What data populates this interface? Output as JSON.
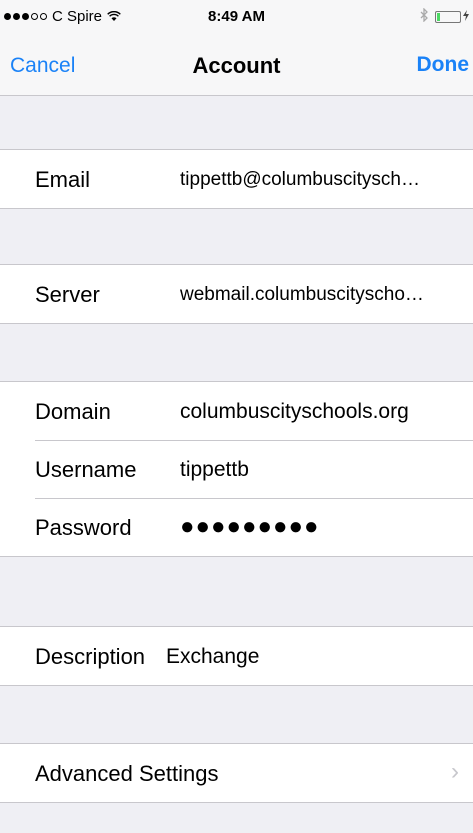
{
  "status_bar": {
    "carrier": "C Spire",
    "time": "8:49 AM",
    "signal_full": 3,
    "signal_empty": 2,
    "icons": [
      "wifi-icon",
      "bluetooth-icon",
      "battery-icon",
      "charging-icon"
    ]
  },
  "nav": {
    "cancel_label": "Cancel",
    "title": "Account",
    "done_label": "Done"
  },
  "fields": {
    "email": {
      "label": "Email",
      "value": "tippettb@columbuscitysch…"
    },
    "server": {
      "label": "Server",
      "value": "webmail.columbuscityscho…"
    },
    "domain": {
      "label": "Domain",
      "value": "columbuscityschools.org"
    },
    "username": {
      "label": "Username",
      "value": "tippettb"
    },
    "password": {
      "label": "Password",
      "value": "●●●●●●●●●"
    },
    "description": {
      "label": "Description",
      "value": "Exchange"
    }
  },
  "advanced": {
    "label": "Advanced Settings",
    "chevron": "›"
  },
  "colors": {
    "accent": "#1a82f7",
    "background": "#efeff4",
    "separator": "#c8c7cc"
  }
}
